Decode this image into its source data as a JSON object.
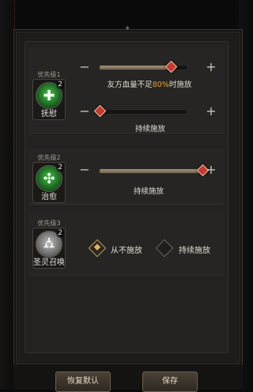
{
  "skills": [
    {
      "priority": "优先级1",
      "name": "抚慰",
      "level": "2",
      "icon": "green-cross-heal-icon",
      "slider_condition": {
        "label_prefix": "友方血量不足",
        "percent": "80%",
        "label_suffix": "时施放",
        "value": 0.8
      },
      "slider_continuous": {
        "label": "持续施放",
        "value": 0.0
      }
    },
    {
      "priority": "优先级2",
      "name": "治愈",
      "level": "2",
      "icon": "green-multi-cross-heal-icon",
      "slider_continuous": {
        "label": "持续施放",
        "value": 1.0
      }
    },
    {
      "priority": "优先级3",
      "name": "圣灵召唤",
      "level": "2",
      "icon": "grey-tombstone-icon",
      "options": [
        {
          "label": "从不施放",
          "checked": true
        },
        {
          "label": "持续施放",
          "checked": false
        }
      ]
    }
  ],
  "buttons": {
    "reset": "恢复默认",
    "save": "保存"
  },
  "colors": {
    "highlight": "#e7a33a",
    "knob": "#c43a35"
  }
}
